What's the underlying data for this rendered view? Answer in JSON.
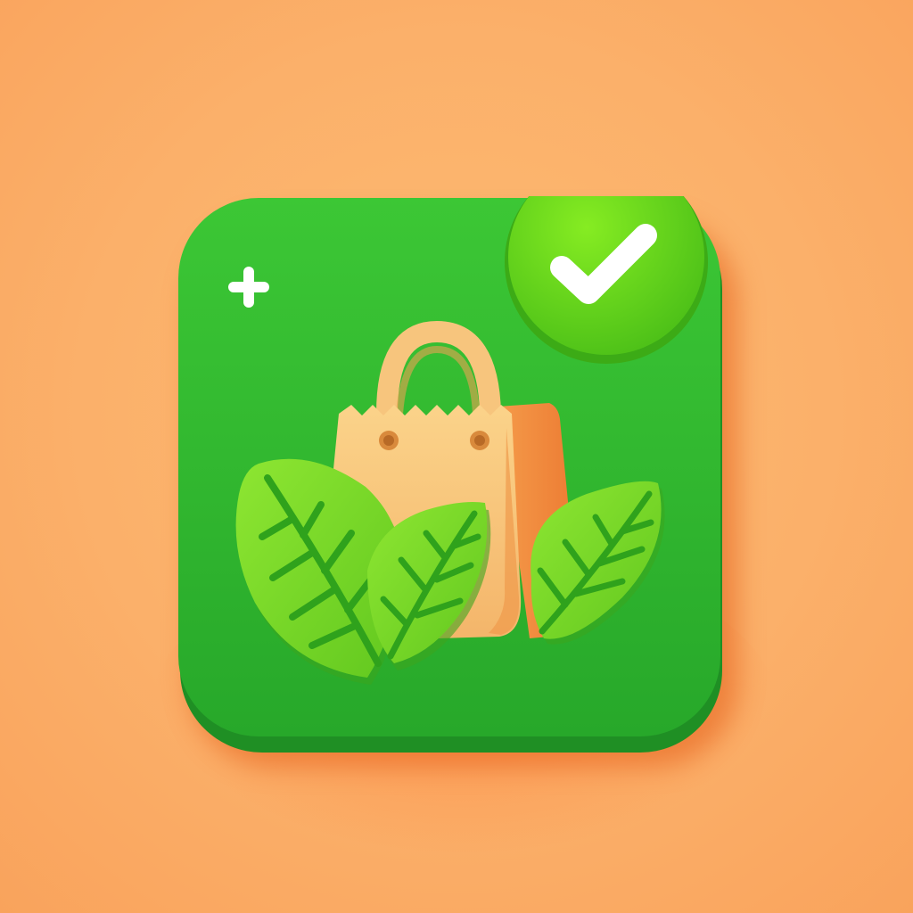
{
  "icon": {
    "name": "eco-shopping-app-icon",
    "elements": [
      "plus-icon",
      "check-badge-icon",
      "shopping-bag-icon",
      "leaf-icon"
    ]
  },
  "colors": {
    "background": "#fbb06a",
    "tile_green": "#2fb82c",
    "tile_green_dark": "#1f8f24",
    "badge_green": "#66d61a",
    "bag_tan": "#f6c47e",
    "bag_orange": "#f08a3c",
    "leaf_green": "#7edc2a",
    "leaf_vein": "#2fa21c",
    "white": "#ffffff"
  }
}
